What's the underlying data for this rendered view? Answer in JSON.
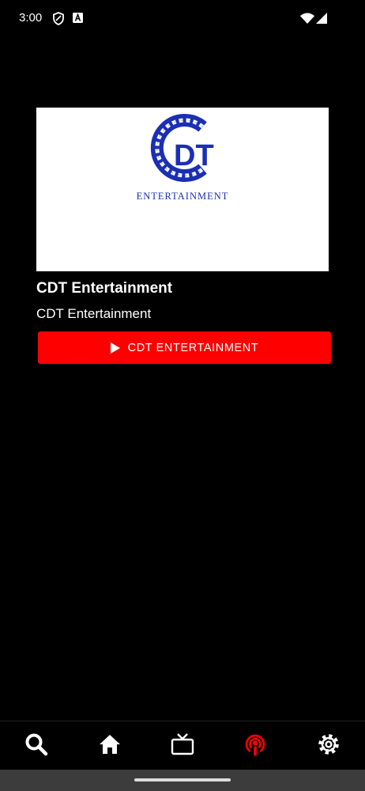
{
  "status_bar": {
    "time": "3:00",
    "icons": [
      "shield-icon",
      "a-badge-icon",
      "wifi-icon",
      "signal-icon"
    ]
  },
  "card": {
    "logo": {
      "wordmark": "DT",
      "tagline": "ENTERTAINMENT",
      "brand_color": "#1b2fb5"
    },
    "title": "CDT Entertainment",
    "subtitle": "CDT Entertainment",
    "play_button_label": "CDT ENTERTAINMENT"
  },
  "bottom_nav": {
    "items": [
      {
        "icon": "search-icon",
        "active": false
      },
      {
        "icon": "home-icon",
        "active": false
      },
      {
        "icon": "tv-icon",
        "active": false
      },
      {
        "icon": "podcast-icon",
        "active": true
      },
      {
        "icon": "gear-icon",
        "active": false
      }
    ],
    "active_color": "#ff0000"
  }
}
